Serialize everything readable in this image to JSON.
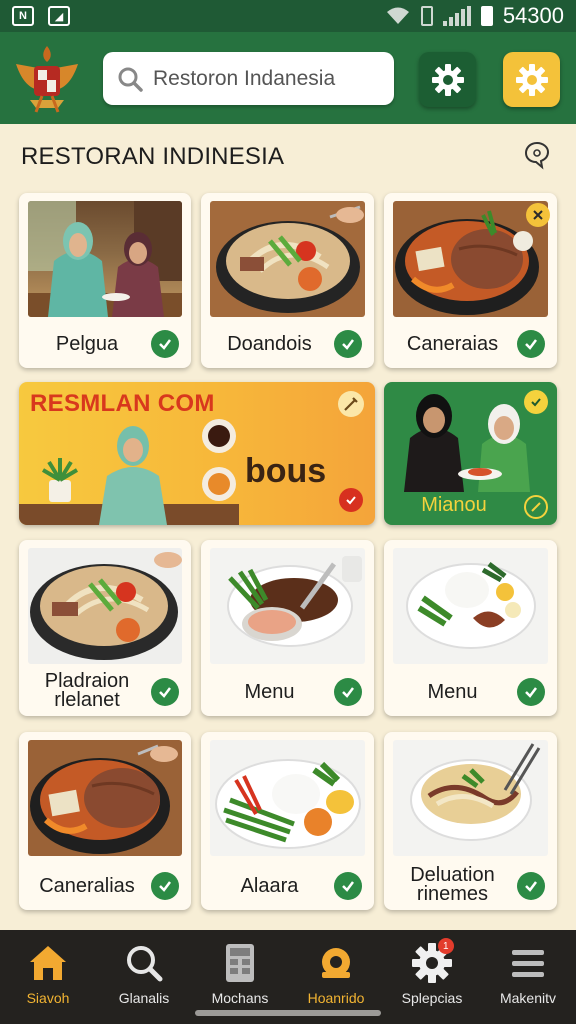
{
  "status_bar": {
    "time": "54300"
  },
  "header": {
    "emblem": "garuda-emblem",
    "search": {
      "value": "Restoron Indanesia",
      "icon": "search-icon"
    },
    "buttons": [
      {
        "icon": "gear-icon"
      },
      {
        "icon": "settings-gear-icon"
      }
    ]
  },
  "page": {
    "title": "RESTORAN INDINESIA"
  },
  "grid": {
    "row1": [
      {
        "label": "Pelgua",
        "checked": true
      },
      {
        "label": "Doandois",
        "checked": true
      },
      {
        "label": "Caneraias",
        "checked": true
      }
    ],
    "banner": {
      "headline": "RESMLAN COM",
      "big_text": "bous"
    },
    "promo": {
      "name": "Mianou"
    },
    "row3": [
      {
        "label_line1": "Pladraion",
        "label_line2": "rlelanet",
        "checked": true
      },
      {
        "label": "Menu",
        "checked": true
      },
      {
        "label": "Menu",
        "checked": true
      }
    ],
    "row4": [
      {
        "label": "Caneralias",
        "checked": true
      },
      {
        "label": "Alaara",
        "checked": true
      },
      {
        "label_line1": "Deluation",
        "label_line2": "rinemes",
        "checked": true
      }
    ]
  },
  "bottom_nav": {
    "items": [
      {
        "label": "Siavoh",
        "icon": "home-icon",
        "active": true
      },
      {
        "label": "Glanalis",
        "icon": "search-icon",
        "active": false
      },
      {
        "label": "Mochans",
        "icon": "menu-grid-icon",
        "active": false
      },
      {
        "label": "Hoanrido",
        "icon": "food-bowl-icon",
        "active": true
      },
      {
        "label": "Splepcias",
        "icon": "gear-icon",
        "active": false,
        "badge": "1"
      },
      {
        "label": "Makenitv",
        "icon": "hamburger-icon",
        "active": false
      }
    ]
  },
  "colors": {
    "primary": "#26723f",
    "accent": "#f4c23a",
    "check": "#2c8b45",
    "background": "#f7eed6"
  }
}
